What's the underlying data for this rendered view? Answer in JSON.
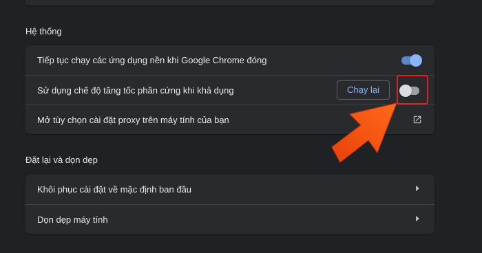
{
  "colors": {
    "background": "#202124",
    "card": "#292a2d",
    "accent": "#8ab4f8",
    "highlight": "#e02020",
    "arrow": "#f04e10"
  },
  "system_section": {
    "title": "Hệ thống",
    "rows": [
      {
        "label": "Tiếp tục chạy các ứng dụng nền khi Google Chrome đóng",
        "toggle": "on"
      },
      {
        "label": "Sử dụng chế độ tăng tốc phần cứng khi khả dụng",
        "toggle": "off",
        "button_label": "Chạy lại"
      },
      {
        "label": "Mở tùy chọn cài đặt proxy trên máy tính của bạn",
        "icon": "open-in-new-icon"
      }
    ]
  },
  "reset_section": {
    "title": "Đặt lại và dọn dẹp",
    "rows": [
      {
        "label": "Khôi phục cài đặt về mặc định ban đầu",
        "icon": "chevron-right-icon"
      },
      {
        "label": "Dọn dẹp máy tính",
        "icon": "chevron-right-icon"
      }
    ]
  }
}
